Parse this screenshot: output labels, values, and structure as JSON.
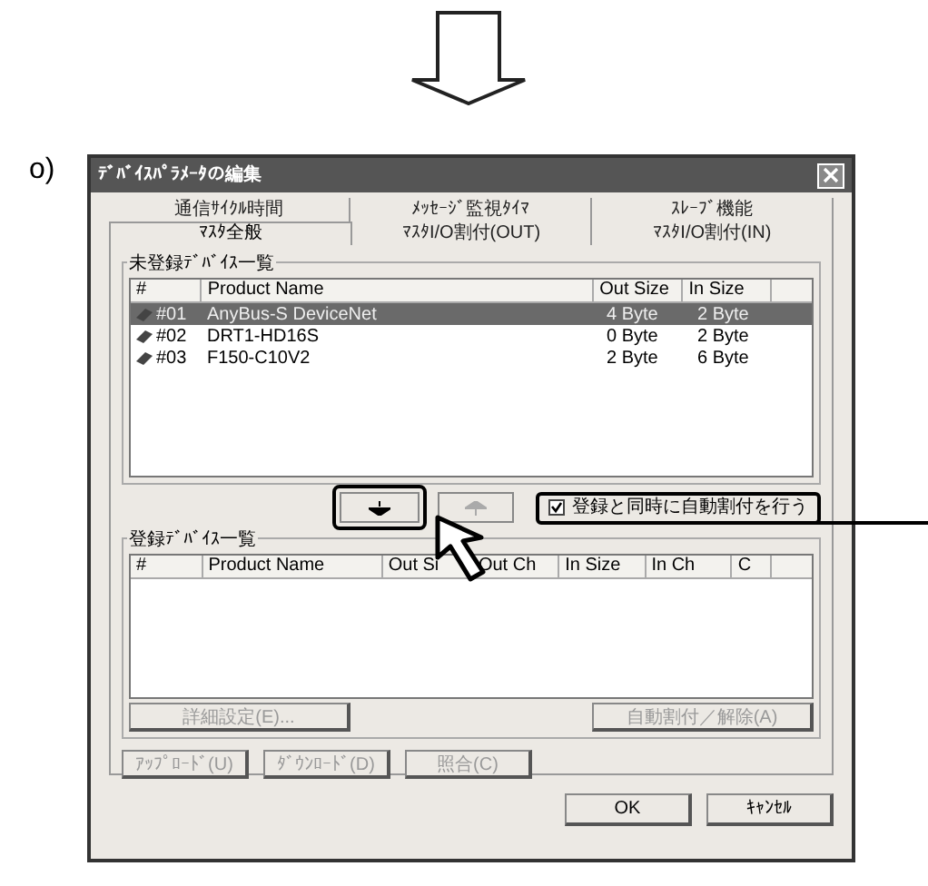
{
  "step_label": "o)",
  "window": {
    "title": "ﾃﾞﾊﾞｲｽﾊﾟﾗﾒｰﾀの編集"
  },
  "tab_rows": [
    [
      {
        "label": "通信ｻｲｸﾙ時間",
        "selected": false
      },
      {
        "label": "ﾒｯｾｰｼﾞ監視ﾀｲﾏ",
        "selected": false
      },
      {
        "label": "ｽﾚｰﾌﾞ機能",
        "selected": false
      }
    ],
    [
      {
        "label": "ﾏｽﾀ全般",
        "selected": true
      },
      {
        "label": "ﾏｽﾀI/O割付(OUT)",
        "selected": false
      },
      {
        "label": "ﾏｽﾀI/O割付(IN)",
        "selected": false
      }
    ]
  ],
  "unregistered": {
    "title": "未登録ﾃﾞﾊﾞｲｽ一覧",
    "columns": [
      "#",
      "Product Name",
      "Out Size",
      "In Size"
    ],
    "rows": [
      {
        "cells": [
          "#01",
          "AnyBus-S DeviceNet",
          "4 Byte",
          "2 Byte"
        ],
        "selected": true
      },
      {
        "cells": [
          "#02",
          "DRT1-HD16S",
          "0 Byte",
          "2 Byte"
        ],
        "selected": false
      },
      {
        "cells": [
          "#03",
          "F150-C10V2",
          "2 Byte",
          "6 Byte"
        ],
        "selected": false
      }
    ]
  },
  "move_buttons": [
    {
      "kind": "down",
      "disabled": false,
      "highlighted": true
    },
    {
      "kind": "up",
      "disabled": true,
      "highlighted": false
    }
  ],
  "auto_assign_checkbox": {
    "label": "登録と同時に自動割付を行う",
    "checked": true
  },
  "registered": {
    "title": "登録ﾃﾞﾊﾞｲｽ一覧",
    "columns": [
      "#",
      "Product Name",
      "Out Si",
      "Out Ch",
      "In Size",
      "In Ch",
      "C"
    ]
  },
  "list_buttons": [
    {
      "label": "詳細設定(E)...",
      "disabled": true
    },
    {
      "label": "自動割付／解除(A)",
      "disabled": true
    }
  ],
  "transfer_buttons": [
    {
      "label": "ｱｯﾌﾟﾛｰﾄﾞ(U)",
      "disabled": true
    },
    {
      "label": "ﾀﾞｳﾝﾛｰﾄﾞ(D)",
      "disabled": true
    },
    {
      "label": "照合(C)",
      "disabled": true
    }
  ],
  "dialog_buttons": [
    {
      "label": "OK",
      "disabled": false
    },
    {
      "label": "ｷｬﾝｾﾙ",
      "disabled": false
    }
  ]
}
